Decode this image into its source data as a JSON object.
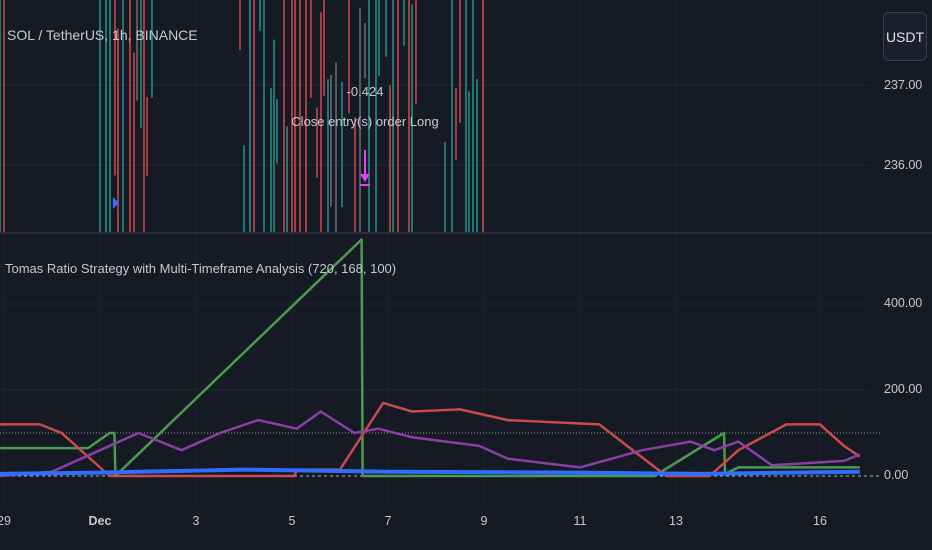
{
  "header": {
    "symbol_title": "SOL / TetherUS, 1h, BINANCE",
    "currency_button": "USDT"
  },
  "price_pane": {
    "price_ticks": [
      "237.00",
      "236.00"
    ],
    "trade_annotation": {
      "value": "-0.424",
      "label": "Close entry(s) order Long"
    }
  },
  "colors": {
    "background": "#161a25",
    "grid": "#232733",
    "green": "#4c9a50",
    "red": "#c94b4b",
    "purple": "#8a3ea6",
    "blue": "#2f6dff",
    "candle_up": "#26a69a",
    "candle_down": "#ef5350",
    "marker": "#e040fb"
  },
  "chart_data": {
    "type": "line",
    "title": "Tomas Ratio Strategy with Multi-Timeframe Analysis (720, 168, 100)",
    "x_unit": "days since Nov 29",
    "x_tick_labels": [
      {
        "label": "29",
        "day": 0
      },
      {
        "label": "Dec",
        "day": 2
      },
      {
        "label": "3",
        "day": 4
      },
      {
        "label": "5",
        "day": 6
      },
      {
        "label": "7",
        "day": 8
      },
      {
        "label": "9",
        "day": 10
      },
      {
        "label": "11",
        "day": 12
      },
      {
        "label": "13",
        "day": 14
      },
      {
        "label": "16",
        "day": 17
      }
    ],
    "y_tick_labels": [
      {
        "label": "400.00",
        "value": 400
      },
      {
        "label": "200.00",
        "value": 200
      },
      {
        "label": "0.00",
        "value": 0
      }
    ],
    "ylim": [
      0,
      560
    ],
    "xlim": [
      -0.08,
      19.3
    ],
    "reference_lines": [
      100,
      0
    ],
    "grid": true,
    "series": [
      {
        "name": "green",
        "color": "#4c9a50",
        "points": [
          [
            -0.1,
            65
          ],
          [
            1.75,
            65
          ],
          [
            2.2,
            100
          ],
          [
            2.3,
            100
          ],
          [
            2.32,
            0
          ],
          [
            7.45,
            550
          ],
          [
            7.47,
            0
          ],
          [
            13.55,
            0
          ],
          [
            15.0,
            100
          ],
          [
            15.02,
            5
          ],
          [
            15.3,
            20
          ],
          [
            17.83,
            20
          ]
        ]
      },
      {
        "name": "red",
        "color": "#c94b4b",
        "points": [
          [
            -0.1,
            120
          ],
          [
            0.75,
            120
          ],
          [
            1.2,
            100
          ],
          [
            2.2,
            0
          ],
          [
            6.05,
            0
          ],
          [
            6.1,
            15
          ],
          [
            7.0,
            15
          ],
          [
            7.9,
            170
          ],
          [
            8.5,
            150
          ],
          [
            9.5,
            155
          ],
          [
            10.5,
            130
          ],
          [
            12.4,
            120
          ],
          [
            13.8,
            0
          ],
          [
            14.7,
            0
          ],
          [
            15.3,
            60
          ],
          [
            16.3,
            120
          ],
          [
            17.0,
            120
          ],
          [
            17.5,
            70
          ],
          [
            17.83,
            45
          ]
        ]
      },
      {
        "name": "purple",
        "color": "#8a3ea6",
        "points": [
          [
            -0.1,
            0
          ],
          [
            1,
            10
          ],
          [
            2,
            60
          ],
          [
            2.8,
            100
          ],
          [
            3.7,
            60
          ],
          [
            4.5,
            100
          ],
          [
            5.3,
            130
          ],
          [
            6.1,
            110
          ],
          [
            6.6,
            150
          ],
          [
            7.3,
            100
          ],
          [
            7.8,
            110
          ],
          [
            8.5,
            90
          ],
          [
            9.9,
            70
          ],
          [
            10.5,
            40
          ],
          [
            12,
            20
          ],
          [
            13.3,
            60
          ],
          [
            14.3,
            80
          ],
          [
            14.8,
            60
          ],
          [
            15.3,
            80
          ],
          [
            16,
            25
          ],
          [
            17.5,
            35
          ],
          [
            17.83,
            50
          ]
        ]
      },
      {
        "name": "blue",
        "color": "#2f6dff",
        "points": [
          [
            -0.1,
            5
          ],
          [
            2,
            8
          ],
          [
            5,
            15
          ],
          [
            8,
            10
          ],
          [
            12,
            8
          ],
          [
            14.5,
            5
          ],
          [
            17.83,
            10
          ]
        ]
      }
    ]
  }
}
